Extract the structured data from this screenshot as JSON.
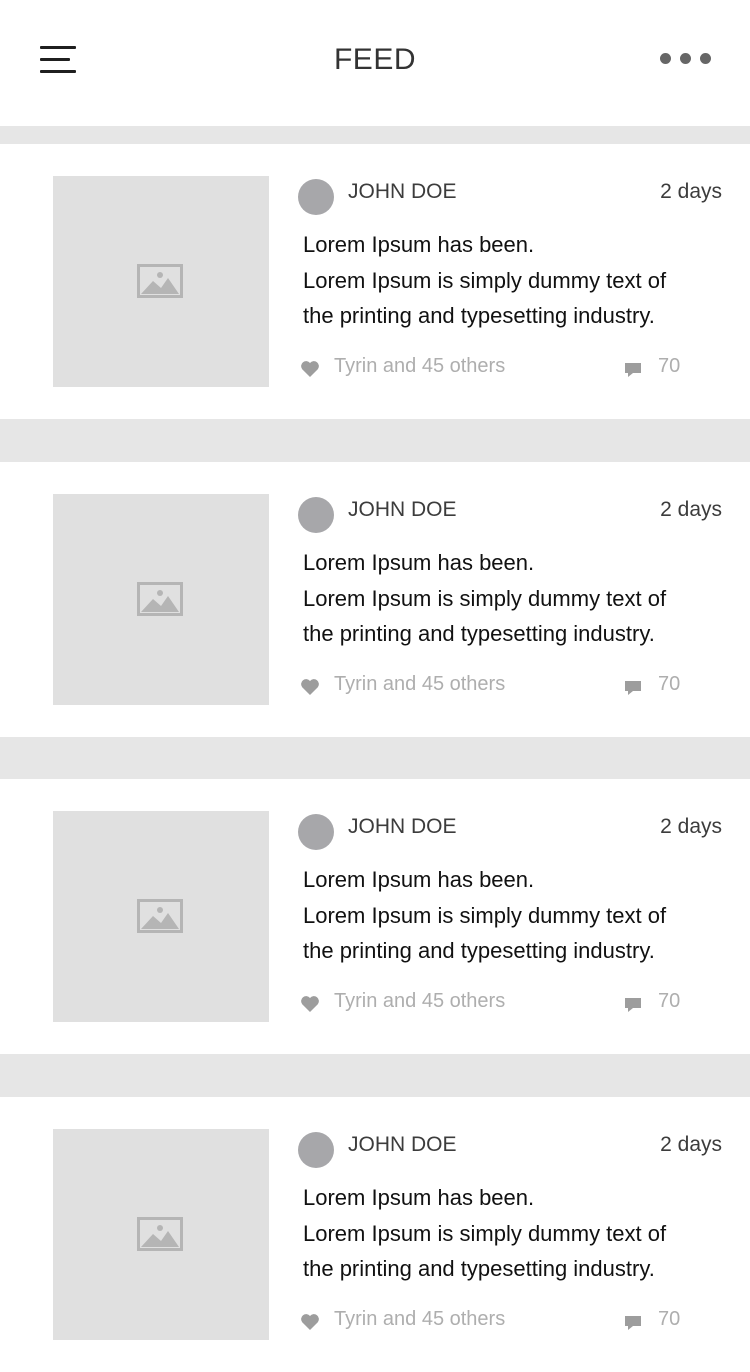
{
  "header": {
    "title": "FEED",
    "menu_icon": "hamburger-menu-icon",
    "more_icon": "more-dots-icon"
  },
  "colors": {
    "separator": "#e6e6e6",
    "image_placeholder": "#e0e0e0",
    "avatar": "#a7a7aa",
    "muted_text": "#aeaeae"
  },
  "posts": [
    {
      "author": "JOHN DOE",
      "time": "2 days",
      "text_line1": "Lorem Ipsum has been.",
      "text_line2": "Lorem Ipsum is simply dummy text of",
      "text_line3": "the printing and typesetting industry.",
      "likes": "Tyrin and 45 others",
      "comments": "70"
    },
    {
      "author": "JOHN DOE",
      "time": "2 days",
      "text_line1": "Lorem Ipsum has been.",
      "text_line2": "Lorem Ipsum is simply dummy text of",
      "text_line3": "the printing and typesetting industry.",
      "likes": "Tyrin and 45 others",
      "comments": "70"
    },
    {
      "author": "JOHN DOE",
      "time": "2 days",
      "text_line1": "Lorem Ipsum has been.",
      "text_line2": "Lorem Ipsum is simply dummy text of",
      "text_line3": "the printing and typesetting industry.",
      "likes": "Tyrin and 45 others",
      "comments": "70"
    },
    {
      "author": "JOHN DOE",
      "time": "2 days",
      "text_line1": "Lorem Ipsum has been.",
      "text_line2": "Lorem Ipsum is simply dummy text of",
      "text_line3": "the printing and typesetting industry.",
      "likes": "Tyrin and 45 others",
      "comments": "70"
    }
  ]
}
